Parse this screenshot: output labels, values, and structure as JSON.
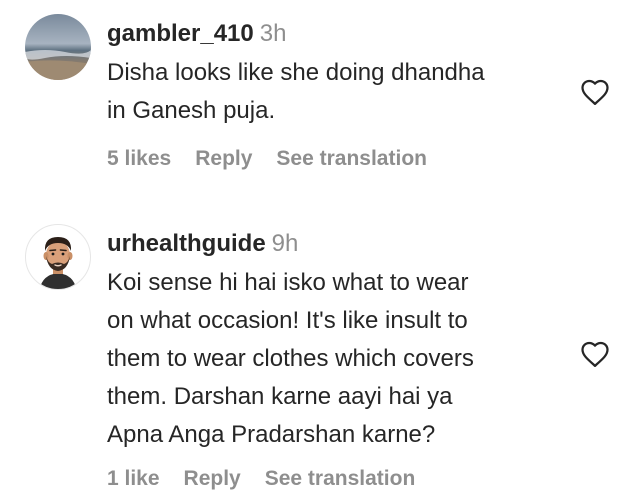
{
  "comments": [
    {
      "username": "gambler_410",
      "time": "3h",
      "text_lines": [
        "Disha looks like she doing dhandha",
        "in Ganesh puja."
      ],
      "likes": "5 likes",
      "reply": "Reply",
      "translation": "See translation",
      "avatar_icon": "beach-photo-avatar",
      "like_icon": "heart-outline-icon"
    },
    {
      "username": "urhealthguide",
      "time": "9h",
      "text_lines": [
        "Koi sense hi hai isko what to wear",
        "on what occasion! It's like insult to",
        "them to wear clothes which covers",
        "them. Darshan karne aayi hai ya",
        "Apna Anga Pradarshan karne?"
      ],
      "likes": "1 like",
      "reply": "Reply",
      "translation": "See translation",
      "avatar_icon": "bearded-man-cartoon-avatar",
      "like_icon": "heart-outline-icon"
    }
  ],
  "colors": {
    "text": "#262626",
    "secondary": "#8e8e8e",
    "background": "#ffffff"
  }
}
